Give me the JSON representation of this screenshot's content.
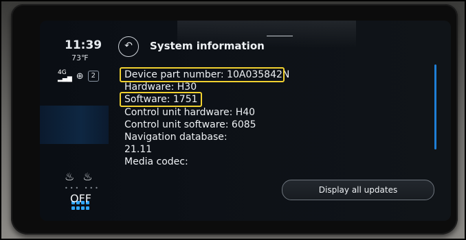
{
  "status": {
    "time": "11:39",
    "temperature": "73℉",
    "network": "4G",
    "badge_count": "2",
    "climate_state": "OFF"
  },
  "header": {
    "title": "System information"
  },
  "info": {
    "lines": [
      "Device part number: 10A035842N",
      "Hardware: H30",
      "Software: 1751",
      "Control unit hardware: H40",
      "Control unit software: 6085",
      "Navigation database:",
      "21.11",
      "Media codec:"
    ]
  },
  "actions": {
    "display_updates_label": "Display all updates"
  },
  "colors": {
    "highlight": "#f2d230",
    "accent_blue": "#2fa6ff"
  },
  "icons": [
    "back-arrow-icon",
    "signal-icon",
    "globe-icon",
    "apps-grid-icon",
    "seat-heat-left-icon",
    "seat-heat-right-icon"
  ]
}
